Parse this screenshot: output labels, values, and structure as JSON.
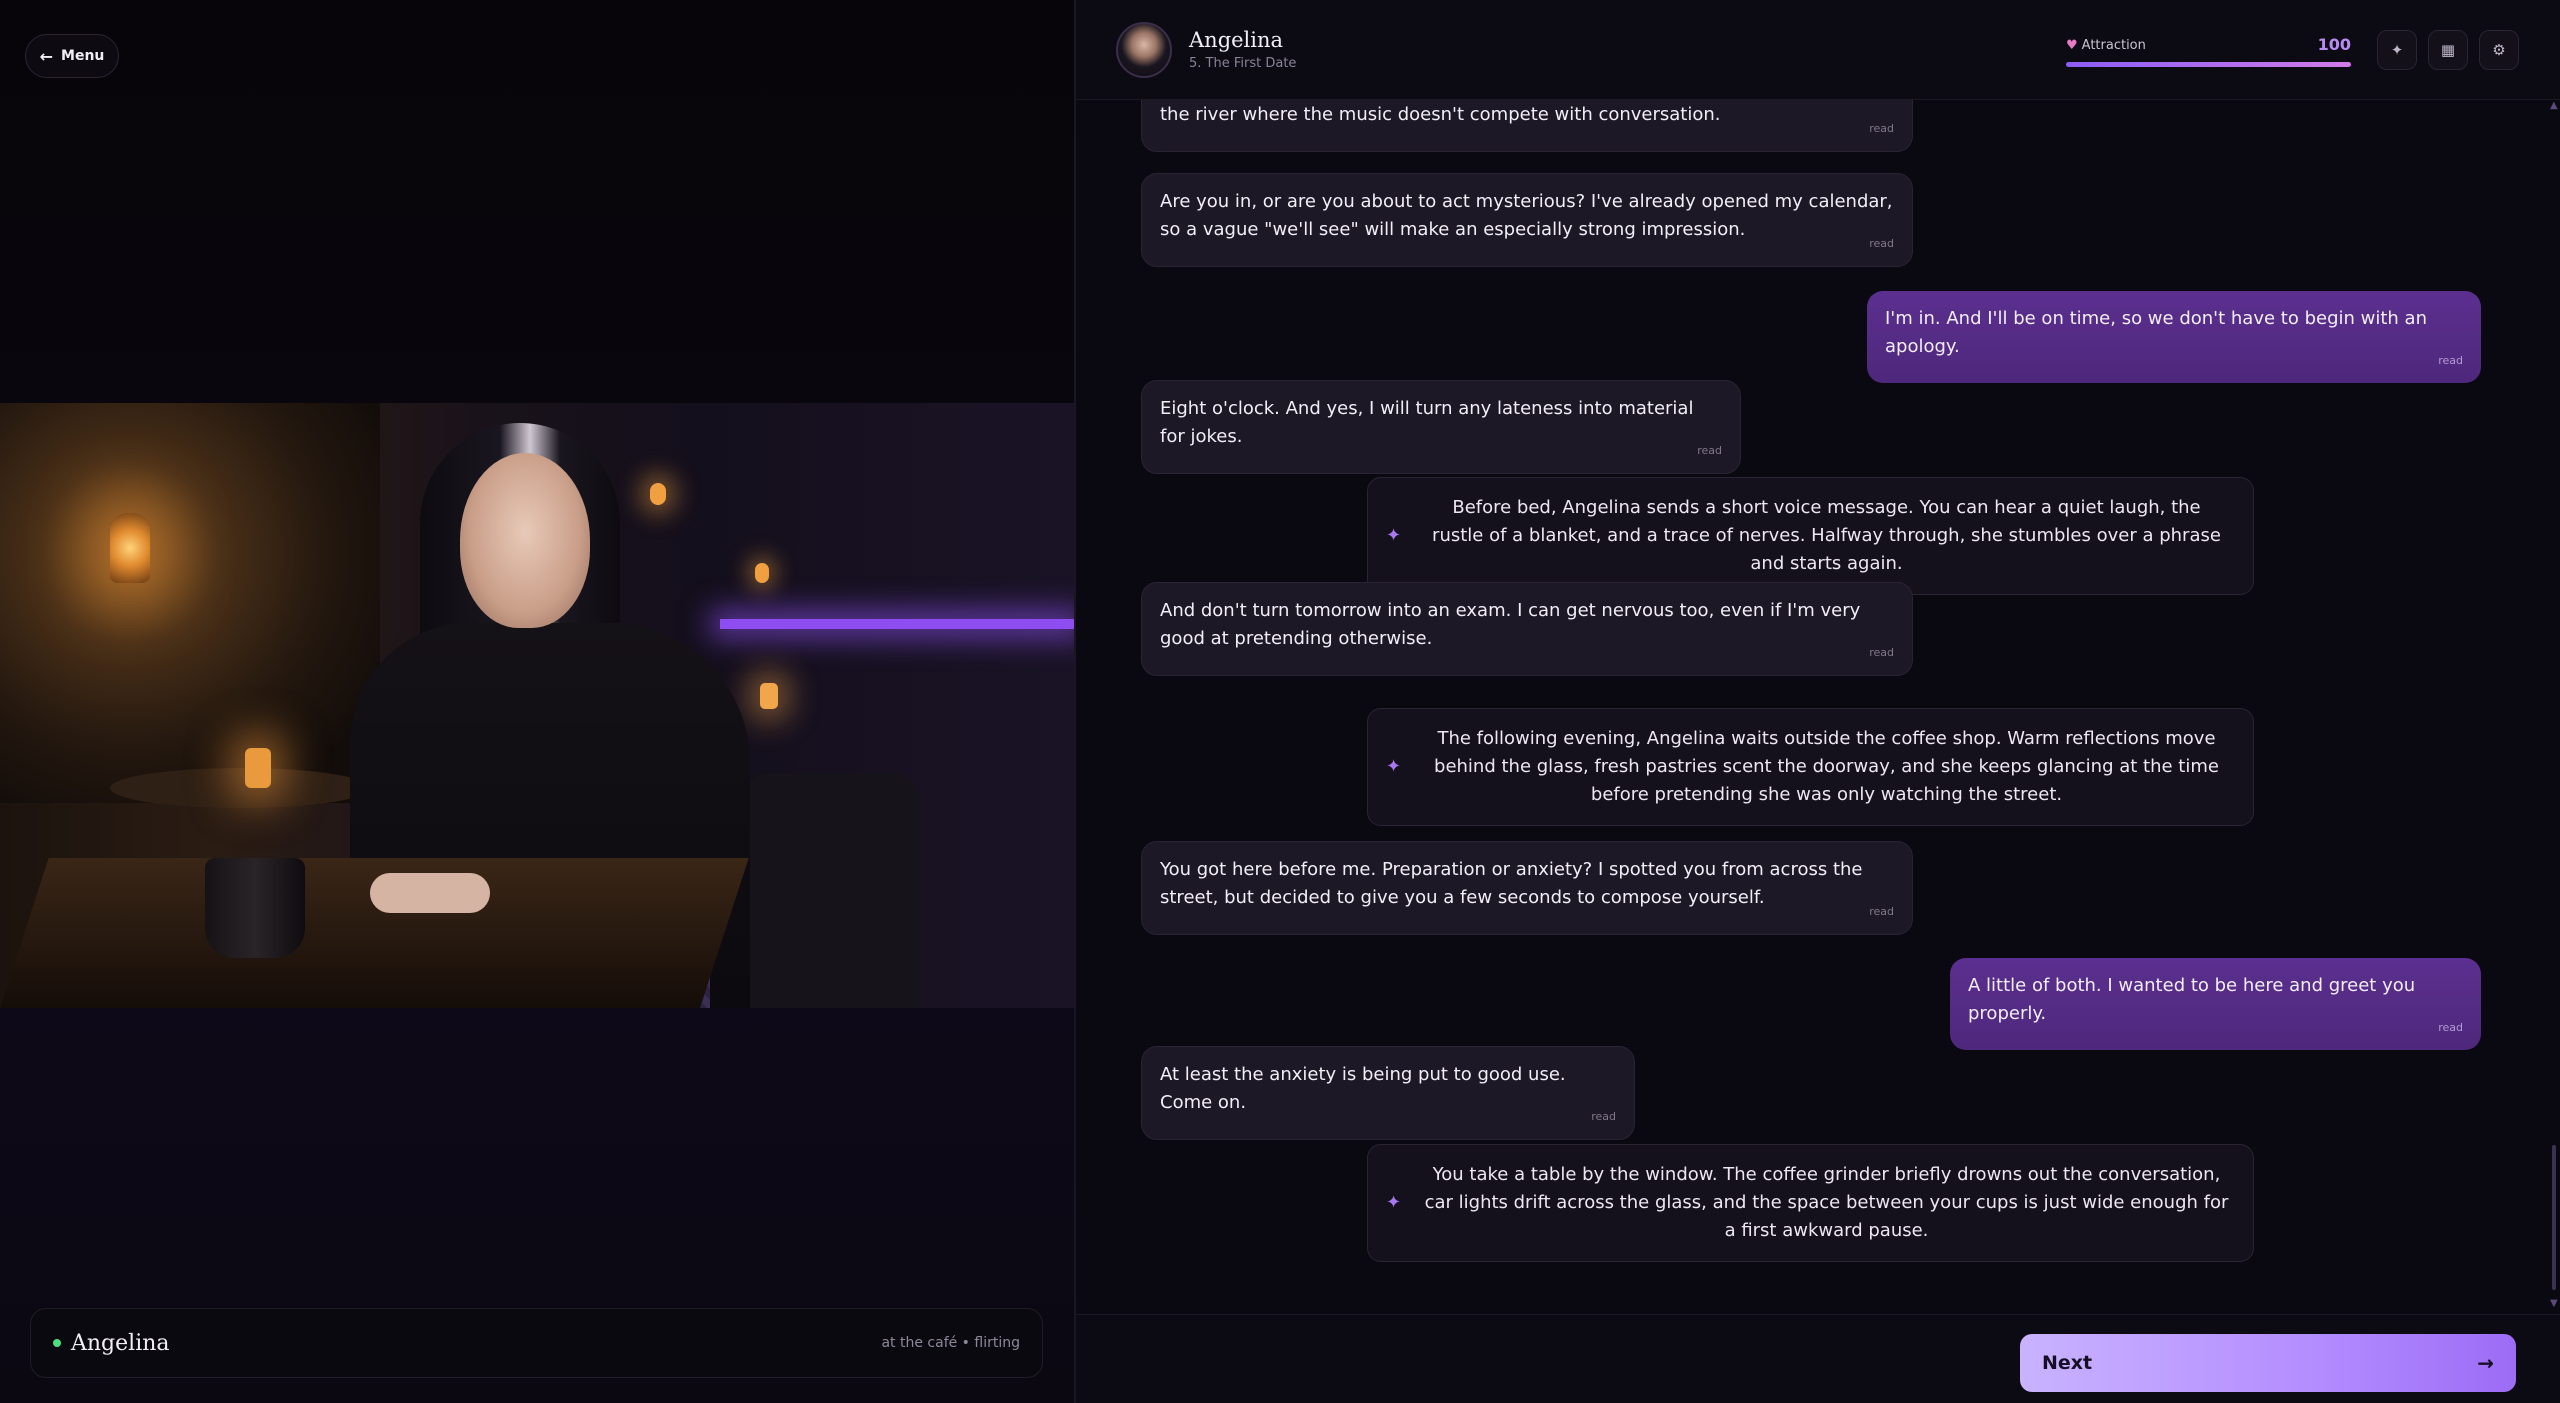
{
  "menu": {
    "label": "Menu",
    "arrow": "←"
  },
  "character": {
    "name": "Angelina",
    "location": "at the café • flirting"
  },
  "header": {
    "name": "Angelina",
    "chapter": "5. The First Date",
    "attraction_label": "Attraction",
    "attraction_value": "100",
    "attraction_level": 1.0,
    "icons": [
      "sparkle-icon",
      "grid-icon",
      "settings-icon"
    ],
    "icon_glyphs": [
      "✦",
      "▦",
      "⚙"
    ]
  },
  "messages": [
    {
      "from": "them",
      "text": "the river where the music doesn't compete with conversation.",
      "status": "read"
    },
    {
      "from": "them",
      "text": "Are you in, or are you about to act mysterious? I've already opened my calendar, so a vague \"we'll see\" will make an especially strong impression.",
      "status": "read"
    },
    {
      "from": "me",
      "text": "I'm in. And I'll be on time, so we don't have to begin with an apology.",
      "status": "read"
    },
    {
      "from": "them",
      "text": "Eight o'clock. And yes, I will turn any lateness into material for jokes.",
      "status": "read"
    },
    {
      "from": "narration",
      "text": "Before bed, Angelina sends a short voice message. You can hear a quiet laugh, the rustle of a blanket, and a trace of nerves. Halfway through, she stumbles over a phrase and starts again."
    },
    {
      "from": "them",
      "text": "And don't turn tomorrow into an exam. I can get nervous too, even if I'm very good at pretending otherwise.",
      "status": "read"
    },
    {
      "from": "narration",
      "text": "The following evening, Angelina waits outside the coffee shop. Warm reflections move behind the glass, fresh pastries scent the doorway, and she keeps glancing at the time before pretending she was only watching the street."
    },
    {
      "from": "them",
      "text": "You got here before me. Preparation or anxiety? I spotted you from across the street, but decided to give you a few seconds to compose yourself.",
      "status": "read"
    },
    {
      "from": "me",
      "text": "A little of both. I wanted to be here and greet you properly.",
      "status": "read"
    },
    {
      "from": "them",
      "text": "At least the anxiety is being put to good use. Come on.",
      "status": "read"
    },
    {
      "from": "narration",
      "text": "You take a table by the window. The coffee grinder briefly drowns out the conversation, car lights drift across the glass, and the space between your cups is just wide enough for a first awkward pause."
    }
  ],
  "next": {
    "label": "Next",
    "arrow": "→"
  },
  "colors": {
    "accent": "#8b5cf6",
    "online": "#4ade80",
    "bubble_me": "#5b2f8f",
    "bubble_them": "#1d1826"
  }
}
